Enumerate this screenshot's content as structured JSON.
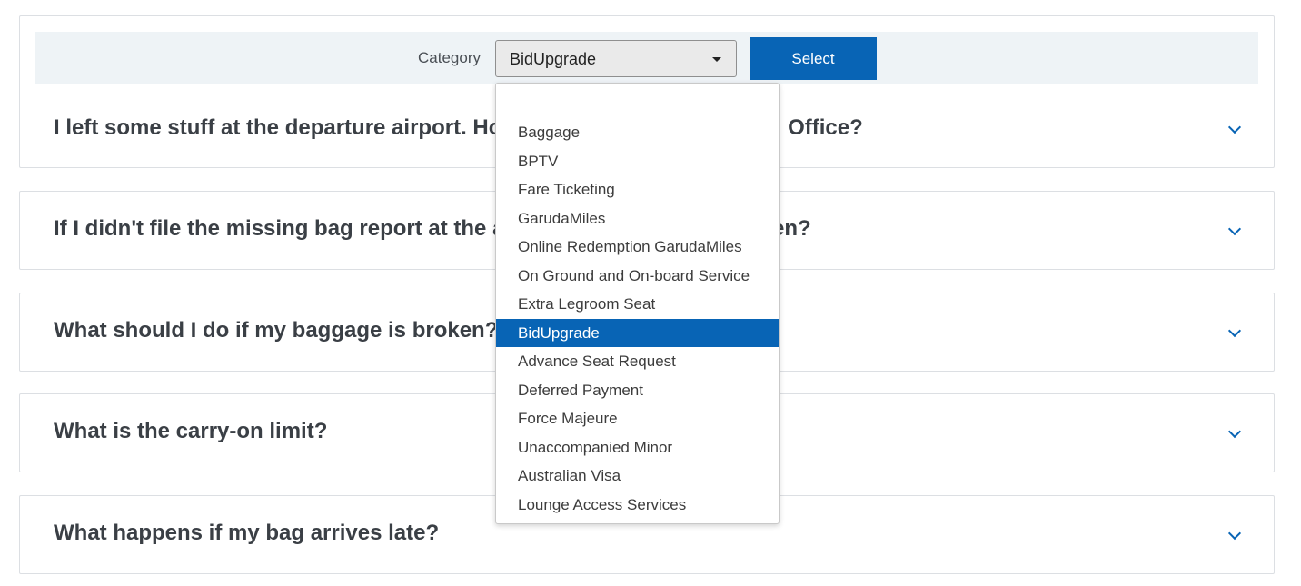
{
  "filter": {
    "label": "Category",
    "selected_value": "BidUpgrade",
    "button_label": "Select"
  },
  "dropdown": {
    "options": [
      "Baggage",
      "BPTV",
      "Fare Ticketing",
      "GarudaMiles",
      "Online Redemption GarudaMiles",
      "On Ground and On-board Service",
      "Extra Legroom Seat",
      "BidUpgrade",
      "Advance Seat Request",
      "Deferred Payment",
      "Force Majeure",
      "Unaccompanied Minor",
      "Australian Visa",
      "Lounge Access Services"
    ],
    "highlighted": "BidUpgrade"
  },
  "faq": [
    {
      "question": "I left some stuff at the departure airport. How can I contact the Ground Office?"
    },
    {
      "question": "If I didn't file the missing bag report at the airport, what should I do then?"
    },
    {
      "question": "What should I do if my baggage is broken?"
    },
    {
      "question": "What is the carry-on limit?"
    },
    {
      "question": "What happens if my bag arrives late?"
    }
  ],
  "icons": {
    "expand": "chevron-down-icon",
    "select_caret": "caret-down-icon"
  },
  "colors": {
    "accent": "#0864b5",
    "filter_bg": "#eef3f6",
    "card_border": "#dcdfe3"
  }
}
